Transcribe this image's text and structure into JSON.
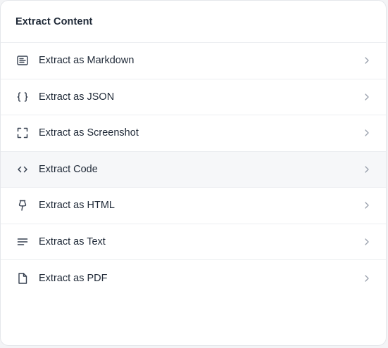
{
  "panel": {
    "title": "Extract Content"
  },
  "items": [
    {
      "label": "Extract as Markdown",
      "icon": "markdown-icon"
    },
    {
      "label": "Extract as JSON",
      "icon": "braces-icon"
    },
    {
      "label": "Extract as Screenshot",
      "icon": "screenshot-frame-icon"
    },
    {
      "label": "Extract Code",
      "icon": "code-icon",
      "highlighted": true
    },
    {
      "label": "Extract as HTML",
      "icon": "pin-icon"
    },
    {
      "label": "Extract as Text",
      "icon": "text-lines-icon"
    },
    {
      "label": "Extract as PDF",
      "icon": "file-icon"
    }
  ],
  "colors": {
    "panel_bg": "#ffffff",
    "divider": "#eceef1",
    "text": "#1f2937",
    "chevron": "#9ca3af",
    "hover_bg": "#f6f7f9"
  }
}
